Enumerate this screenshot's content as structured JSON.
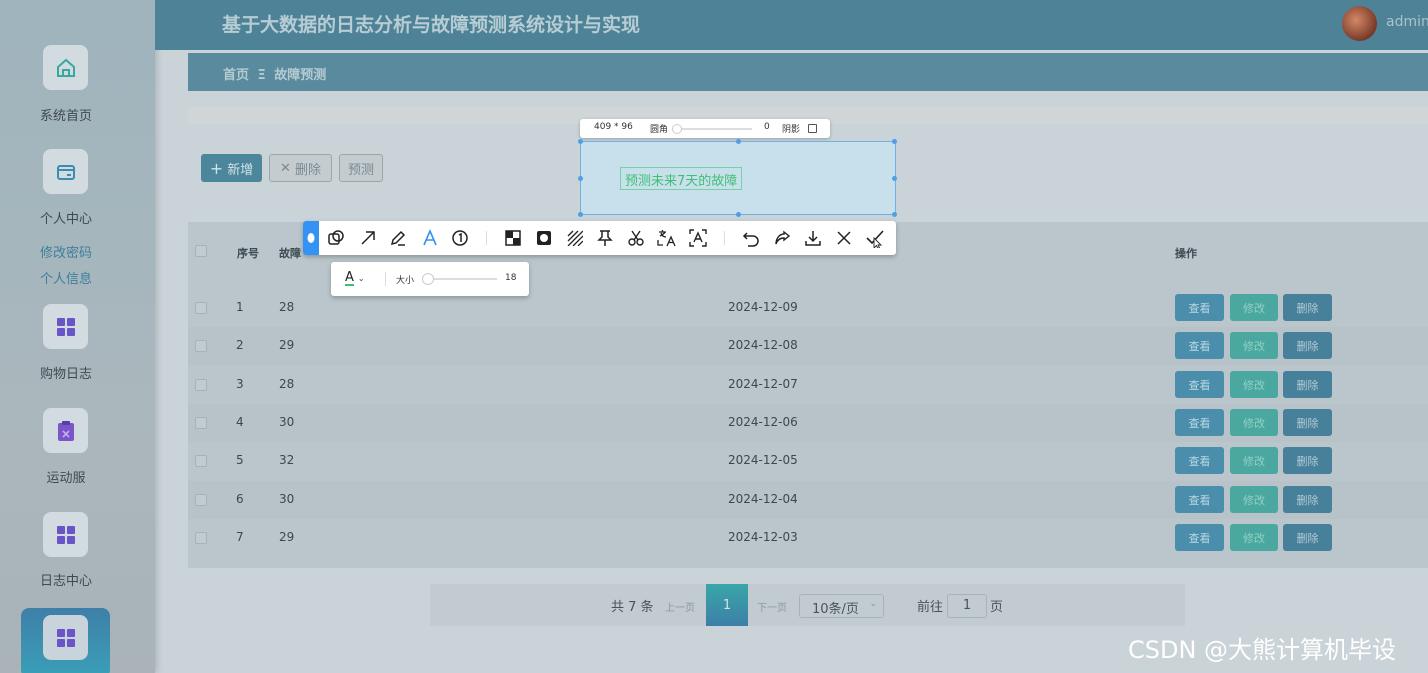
{
  "app": {
    "title": "基于大数据的日志分析与故障预测系统设计与实现",
    "user": "admin"
  },
  "breadcrumb": {
    "home": "首页",
    "separator": "Ξ",
    "current": "故障预测"
  },
  "sidebar": {
    "items": [
      {
        "label": "系统首页",
        "icon": "home-icon"
      },
      {
        "label": "个人中心",
        "icon": "wallet-icon",
        "subitems": [
          "修改密码",
          "个人信息"
        ]
      },
      {
        "label": "购物日志",
        "icon": "grid-icon"
      },
      {
        "label": "运动服",
        "icon": "clipboard-icon"
      },
      {
        "label": "日志中心",
        "icon": "grid-icon"
      },
      {
        "label": "",
        "icon": "grid-icon",
        "active": true
      }
    ]
  },
  "toolbar": {
    "add_label": "新增",
    "delete_label": "删除",
    "predict_label": "预测"
  },
  "table": {
    "headers": {
      "index": "序号",
      "fault": "故障",
      "date": "",
      "actions": "操作"
    },
    "rows": [
      {
        "index": "1",
        "fault": "28",
        "date": "2024-12-09"
      },
      {
        "index": "2",
        "fault": "29",
        "date": "2024-12-08"
      },
      {
        "index": "3",
        "fault": "28",
        "date": "2024-12-07"
      },
      {
        "index": "4",
        "fault": "30",
        "date": "2024-12-06"
      },
      {
        "index": "5",
        "fault": "32",
        "date": "2024-12-05"
      },
      {
        "index": "6",
        "fault": "30",
        "date": "2024-12-04"
      },
      {
        "index": "7",
        "fault": "29",
        "date": "2024-12-03"
      }
    ],
    "row_actions": {
      "view": "查看",
      "edit": "修改",
      "delete": "删除"
    }
  },
  "pagination": {
    "total": "共 7 条",
    "prev": "上一页",
    "page": "1",
    "next": "下一页",
    "page_size": "10条/页",
    "goto_label": "前往",
    "goto_value": "1",
    "goto_suffix": "页"
  },
  "screenshot_overlay": {
    "dimensions": "409 * 96",
    "radius_label": "圆角",
    "radius_value": "0",
    "shadow_label": "阴影",
    "annotation_text": "预测未来7天的故障",
    "font_size_label": "大小",
    "font_size_value": "18",
    "font_size_fraction": 0.04
  },
  "watermark": "CSDN @大熊计算机毕设",
  "colors": {
    "accent": "#4e8397",
    "selection": "#4f9fe6",
    "annotation": "#3fbf75"
  }
}
